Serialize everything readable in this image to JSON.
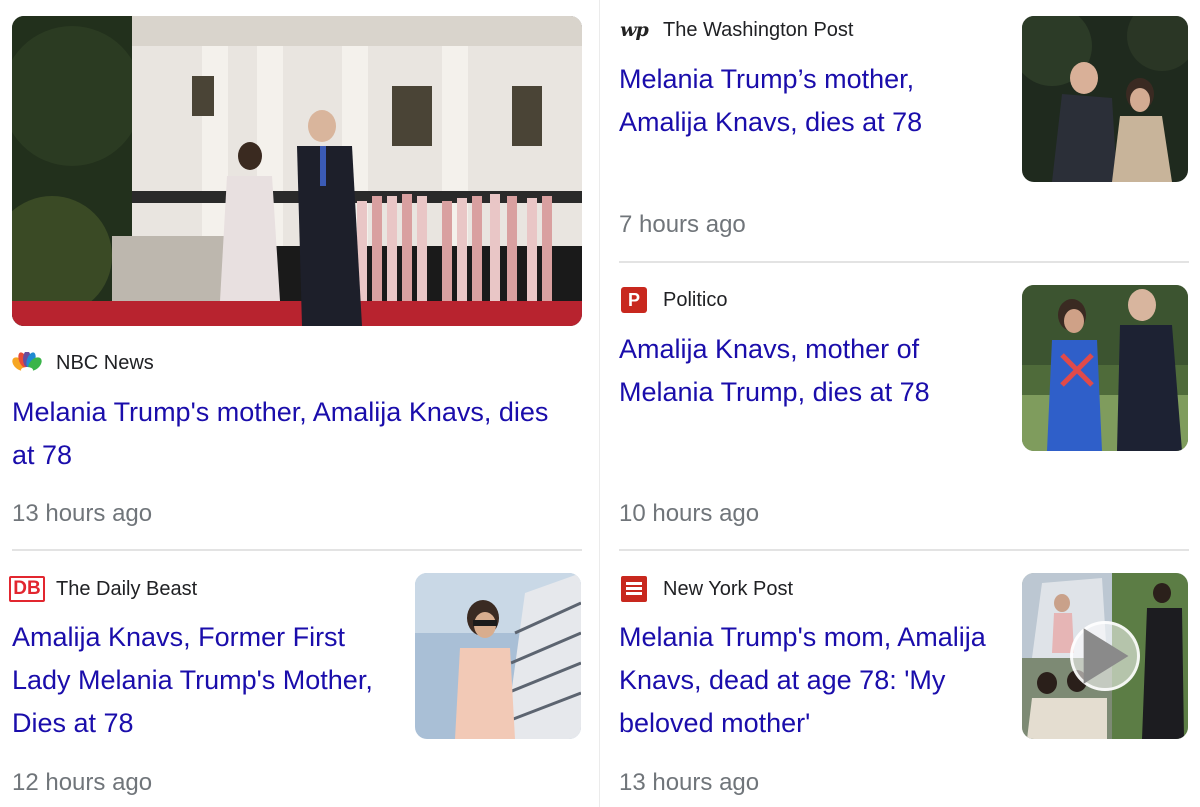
{
  "articles": [
    {
      "source": "NBC News",
      "headline": "Melania Trump's mother, Amalija Knavs, dies at 78",
      "time": "13 hours ago",
      "logo_icon": "nbc-peacock-icon",
      "image": "melania-trump-and-viktor-knavs-white-house-photo"
    },
    {
      "source": "The Washington Post",
      "headline": "Melania Trump’s mother, Amalija Knavs, dies at 78",
      "time": "7 hours ago",
      "logo_icon": "washington-post-icon",
      "image": "viktor-and-amalija-knavs-photo"
    },
    {
      "source": "Politico",
      "headline": "Amalija Knavs, mother of Melania Trump, dies at 78",
      "time": "10 hours ago",
      "logo_icon": "politico-icon",
      "image": "amalija-and-viktor-knavs-walking-photo"
    },
    {
      "source": "The Daily Beast",
      "headline": "Amalija Knavs, Former First Lady Melania Trump's Mother, Dies at 78",
      "time": "12 hours ago",
      "logo_icon": "daily-beast-icon",
      "image": "amalija-knavs-airplane-stairs-photo"
    },
    {
      "source": "New York Post",
      "headline": "Melania Trump's mom, Amalija Knavs, dead at age 78: 'My beloved mother'",
      "time": "13 hours ago",
      "logo_icon": "new-york-post-icon",
      "image": "amalija-knavs-collage-video-thumbnail"
    }
  ],
  "colors": {
    "headline": "#1a0dab",
    "time": "#70757a",
    "source": "#202124",
    "divider": "#e3e3e3"
  }
}
